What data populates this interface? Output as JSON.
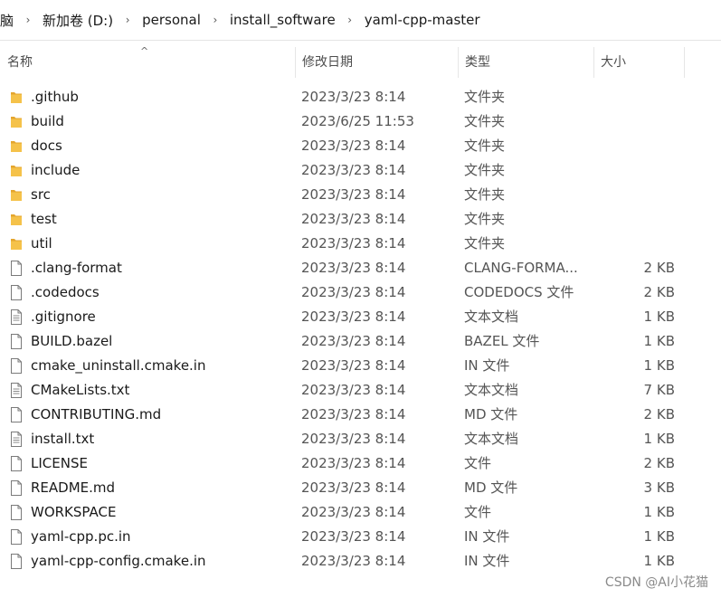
{
  "breadcrumb": [
    "脑",
    "新加卷 (D:)",
    "personal",
    "install_software",
    "yaml-cpp-master"
  ],
  "columns": {
    "name": "名称",
    "date": "修改日期",
    "type": "类型",
    "size": "大小"
  },
  "sort": {
    "column": "name",
    "icon": "sort-ascending-icon"
  },
  "files": [
    {
      "name": ".github",
      "date": "2023/3/23 8:14",
      "type": "文件夹",
      "size": "",
      "icon": "folder-icon"
    },
    {
      "name": "build",
      "date": "2023/6/25 11:53",
      "type": "文件夹",
      "size": "",
      "icon": "folder-icon"
    },
    {
      "name": "docs",
      "date": "2023/3/23 8:14",
      "type": "文件夹",
      "size": "",
      "icon": "folder-icon"
    },
    {
      "name": "include",
      "date": "2023/3/23 8:14",
      "type": "文件夹",
      "size": "",
      "icon": "folder-icon"
    },
    {
      "name": "src",
      "date": "2023/3/23 8:14",
      "type": "文件夹",
      "size": "",
      "icon": "folder-icon"
    },
    {
      "name": "test",
      "date": "2023/3/23 8:14",
      "type": "文件夹",
      "size": "",
      "icon": "folder-icon"
    },
    {
      "name": "util",
      "date": "2023/3/23 8:14",
      "type": "文件夹",
      "size": "",
      "icon": "folder-icon"
    },
    {
      "name": ".clang-format",
      "date": "2023/3/23 8:14",
      "type": "CLANG-FORMA...",
      "size": "2 KB",
      "icon": "file-icon"
    },
    {
      "name": ".codedocs",
      "date": "2023/3/23 8:14",
      "type": "CODEDOCS 文件",
      "size": "2 KB",
      "icon": "file-icon"
    },
    {
      "name": ".gitignore",
      "date": "2023/3/23 8:14",
      "type": "文本文档",
      "size": "1 KB",
      "icon": "text-file-icon"
    },
    {
      "name": "BUILD.bazel",
      "date": "2023/3/23 8:14",
      "type": "BAZEL 文件",
      "size": "1 KB",
      "icon": "file-icon"
    },
    {
      "name": "cmake_uninstall.cmake.in",
      "date": "2023/3/23 8:14",
      "type": "IN 文件",
      "size": "1 KB",
      "icon": "file-icon"
    },
    {
      "name": "CMakeLists.txt",
      "date": "2023/3/23 8:14",
      "type": "文本文档",
      "size": "7 KB",
      "icon": "text-file-icon"
    },
    {
      "name": "CONTRIBUTING.md",
      "date": "2023/3/23 8:14",
      "type": "MD 文件",
      "size": "2 KB",
      "icon": "file-icon"
    },
    {
      "name": "install.txt",
      "date": "2023/3/23 8:14",
      "type": "文本文档",
      "size": "1 KB",
      "icon": "text-file-icon"
    },
    {
      "name": "LICENSE",
      "date": "2023/3/23 8:14",
      "type": "文件",
      "size": "2 KB",
      "icon": "file-icon"
    },
    {
      "name": "README.md",
      "date": "2023/3/23 8:14",
      "type": "MD 文件",
      "size": "3 KB",
      "icon": "file-icon"
    },
    {
      "name": "WORKSPACE",
      "date": "2023/3/23 8:14",
      "type": "文件",
      "size": "1 KB",
      "icon": "file-icon"
    },
    {
      "name": "yaml-cpp.pc.in",
      "date": "2023/3/23 8:14",
      "type": "IN 文件",
      "size": "1 KB",
      "icon": "file-icon"
    },
    {
      "name": "yaml-cpp-config.cmake.in",
      "date": "2023/3/23 8:14",
      "type": "IN 文件",
      "size": "1 KB",
      "icon": "file-icon"
    }
  ],
  "watermark": "CSDN @AI小花猫",
  "colors": {
    "folder": "#f5c24a",
    "folder_dark": "#e4a52e",
    "file_border": "#7a7a7a"
  }
}
